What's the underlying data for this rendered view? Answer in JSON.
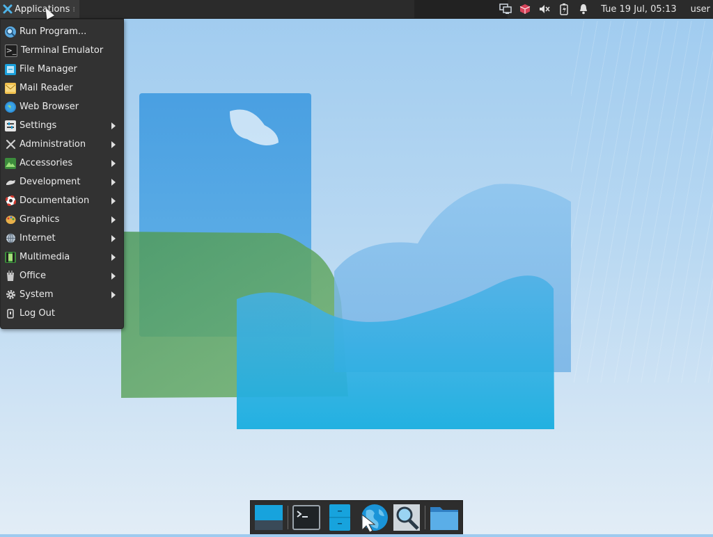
{
  "topbar": {
    "applications_label": "Applications",
    "clock": "Tue 19 Jul, 05:13",
    "user": "user",
    "tray_icons": [
      "network-icon",
      "package-update-icon",
      "volume-muted-icon",
      "battery-charging-icon",
      "notification-bell-icon"
    ]
  },
  "menu": {
    "items": [
      {
        "label": "Run Program...",
        "icon": "search-icon",
        "submenu": false
      },
      {
        "label": "Terminal Emulator",
        "icon": "terminal-icon",
        "submenu": false
      },
      {
        "label": "File Manager",
        "icon": "file-manager-icon",
        "submenu": false
      },
      {
        "label": "Mail Reader",
        "icon": "mail-icon",
        "submenu": false
      },
      {
        "label": "Web Browser",
        "icon": "globe-icon",
        "submenu": false
      },
      {
        "label": "Settings",
        "icon": "settings-icon",
        "submenu": true
      },
      {
        "label": "Administration",
        "icon": "tools-icon",
        "submenu": true
      },
      {
        "label": "Accessories",
        "icon": "accessories-icon",
        "submenu": true
      },
      {
        "label": "Development",
        "icon": "development-icon",
        "submenu": true
      },
      {
        "label": "Documentation",
        "icon": "lifebuoy-icon",
        "submenu": true
      },
      {
        "label": "Graphics",
        "icon": "palette-icon",
        "submenu": true
      },
      {
        "label": "Internet",
        "icon": "internet-icon",
        "submenu": true
      },
      {
        "label": "Multimedia",
        "icon": "multimedia-icon",
        "submenu": true
      },
      {
        "label": "Office",
        "icon": "office-icon",
        "submenu": true
      },
      {
        "label": "System",
        "icon": "gear-icon",
        "submenu": true
      },
      {
        "label": "Log Out",
        "icon": "logout-icon",
        "submenu": false
      }
    ]
  },
  "dock": {
    "items": [
      "show-desktop-icon",
      "terminal-icon",
      "file-manager-icon",
      "web-browser-icon",
      "app-finder-icon",
      "folder-icon"
    ]
  },
  "colors": {
    "panel": "#2b2b2b",
    "menu": "#323232",
    "accent": "#1aa0dc"
  }
}
